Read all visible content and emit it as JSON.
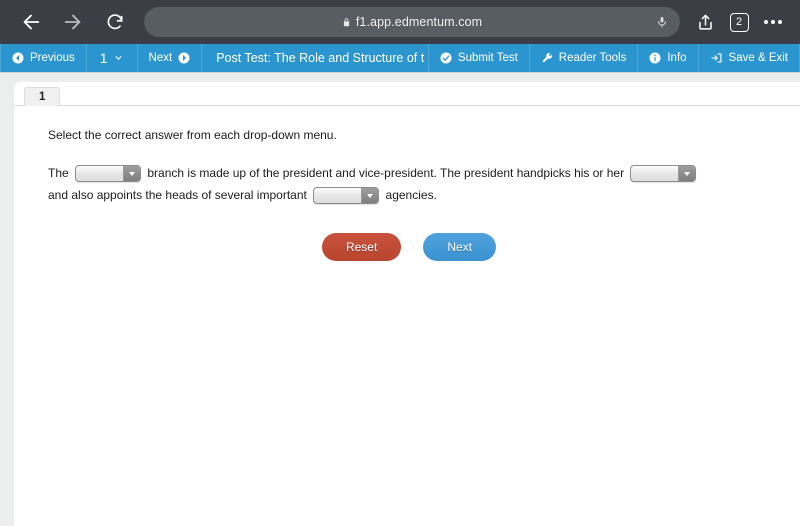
{
  "browser": {
    "back_icon": "back-arrow-icon",
    "forward_icon": "forward-arrow-icon",
    "reload_icon": "reload-icon",
    "url": "f1.app.edmentum.com",
    "lock_icon": "lock-icon",
    "mic_icon": "microphone-icon",
    "share_icon": "share-icon",
    "tab_count": "2",
    "more_icon": "more-options-icon"
  },
  "toolbar": {
    "previous_label": "Previous",
    "page_number": "1",
    "page_caret": "⌄",
    "next_label": "Next",
    "title": "Post Test: The Role and Structure of t",
    "submit_label": "Submit Test",
    "reader_tools_label": "Reader Tools",
    "info_label": "Info",
    "save_exit_label": "Save & Exit"
  },
  "question": {
    "tab_label": "1",
    "instruction": "Select the correct answer from each drop-down menu.",
    "text_part1": "The",
    "text_part2": "branch is made up of the president and vice-president. The president handpicks his or her",
    "text_part3": "and also appoints the heads of several important",
    "text_part4": "agencies.",
    "dropdown1_value": "",
    "dropdown2_value": "",
    "dropdown3_value": ""
  },
  "buttons": {
    "reset_label": "Reset",
    "next_label": "Next"
  },
  "colors": {
    "toolbar_blue": "#2b95cf",
    "chrome_gray": "#3b3f45",
    "reset_red": "#c0492f",
    "next_blue": "#4397d6"
  }
}
